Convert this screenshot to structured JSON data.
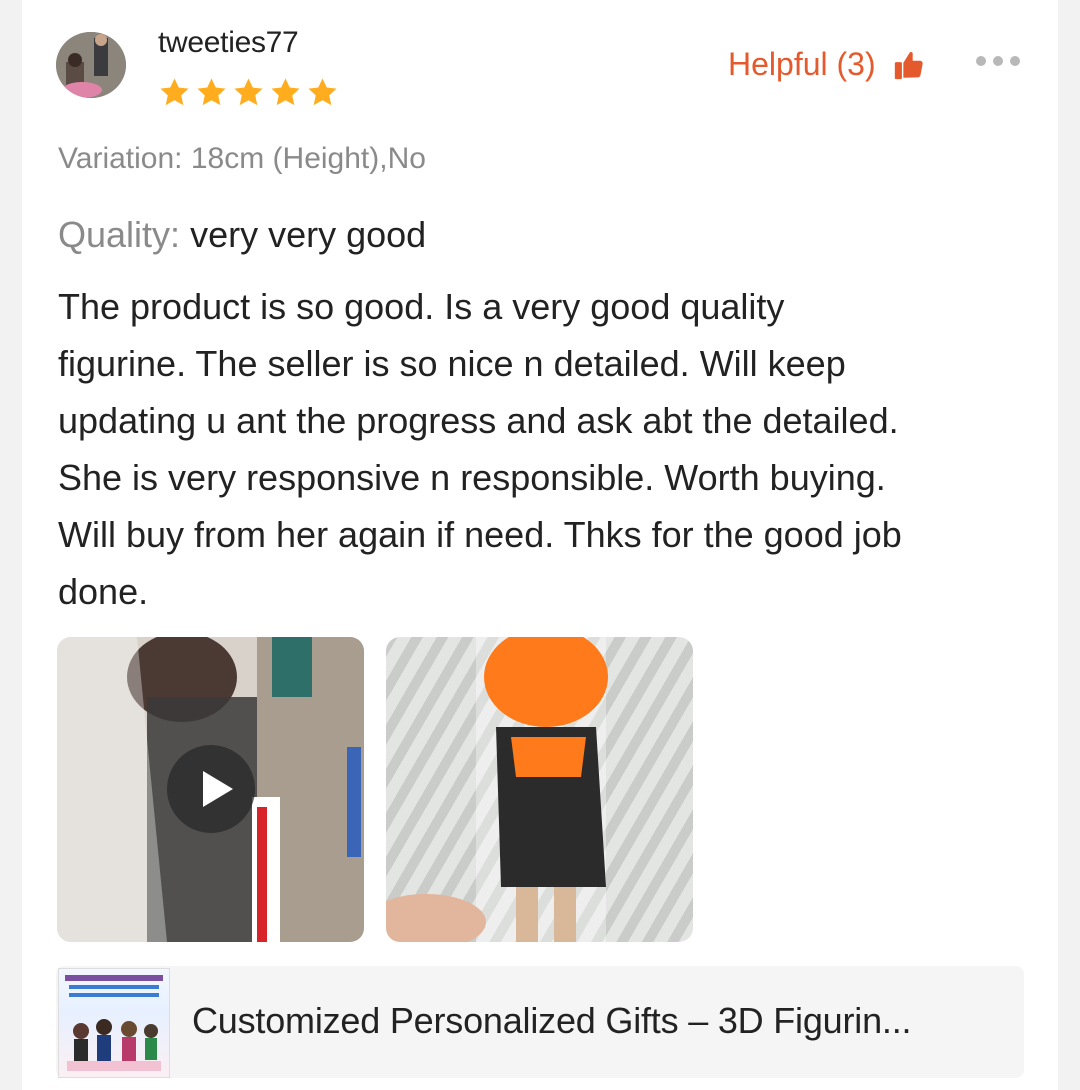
{
  "review": {
    "username": "tweeties77",
    "rating": 5,
    "helpful_label": "Helpful (3)",
    "variation": "Variation: 18cm (Height),No",
    "quality_label": "Quality:",
    "quality_value": "very very good",
    "lines": [
      "The product is so good. Is a very good quality",
      "figurine. The seller is so nice n detailed. Will keep",
      "updating u ant the progress and ask abt the detailed.",
      "She is very responsive n responsible. Worth buying.",
      "Will buy from her again if need. Thks for the good job",
      "done."
    ]
  },
  "product": {
    "title": "Customized Personalized Gifts – 3D Figurin..."
  },
  "colors": {
    "accent": "#e55a2c",
    "star": "#ffad1f",
    "muted_text": "#8a8a8a"
  },
  "icons": {
    "thumb": "thumbs-up-icon",
    "more": "more-dots-icon",
    "play": "play-icon"
  }
}
